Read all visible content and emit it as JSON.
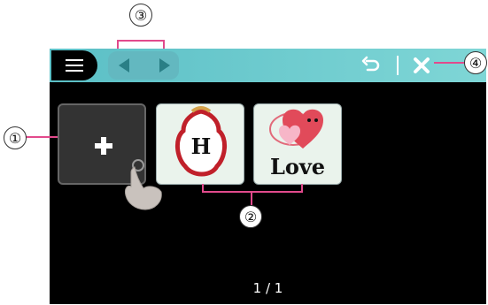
{
  "toolbar": {
    "menu_icon": "hamburger-menu-icon",
    "prev_icon": "chevron-left-icon",
    "next_icon": "chevron-right-icon",
    "undo_icon": "undo-icon",
    "close_icon": "close-icon",
    "accent": "#5bbfc6"
  },
  "designs": [
    {
      "label": "",
      "icon": "monogram-frame-icon"
    },
    {
      "label": "Love",
      "icon": "love-hearts-icon"
    }
  ],
  "add_tile": {
    "icon": "plus-icon",
    "pointer": "hand-pointer-icon"
  },
  "pagination": {
    "text": "1 / 1"
  },
  "callouts": {
    "one": "①",
    "two": "②",
    "three": "③",
    "four": "④"
  },
  "colors": {
    "callout_line": "#e24a8c",
    "screen_bg": "#000000"
  }
}
